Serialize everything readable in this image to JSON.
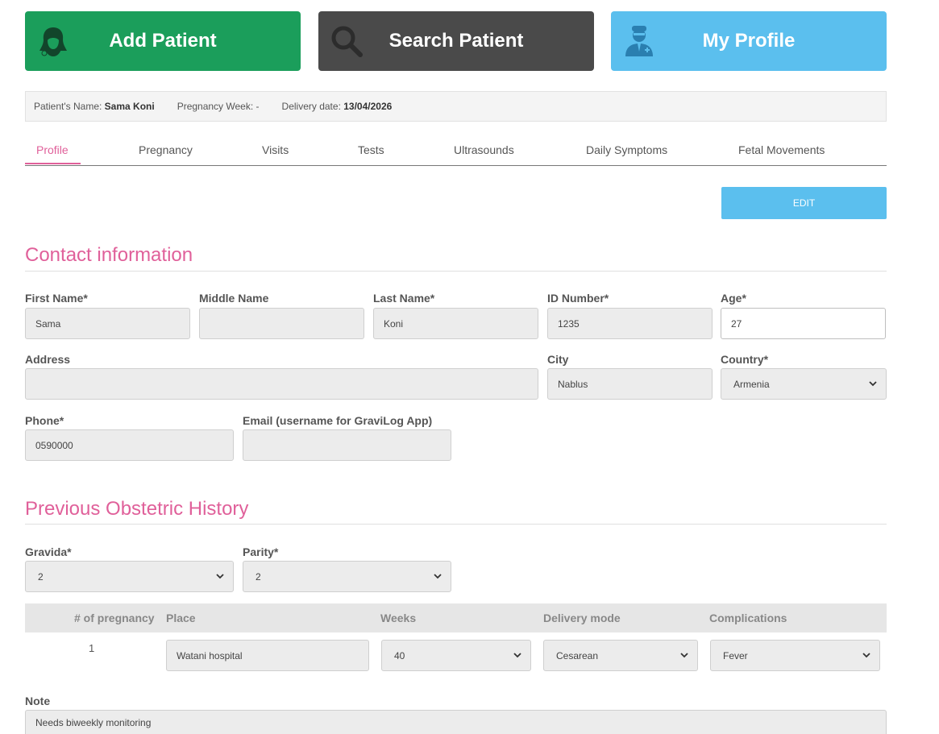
{
  "top_buttons": {
    "add": "Add Patient",
    "search": "Search Patient",
    "profile": "My Profile"
  },
  "info_bar": {
    "name_label": "Patient's Name:",
    "name_value": "Sama Koni",
    "week_label": "Pregnancy Week:",
    "week_value": "-",
    "delivery_label": "Delivery date:",
    "delivery_value": "13/04/2026"
  },
  "tabs": [
    "Profile",
    "Pregnancy",
    "Visits",
    "Tests",
    "Ultrasounds",
    "Daily Symptoms",
    "Fetal Movements"
  ],
  "edit_label": "EDIT",
  "contact": {
    "title": "Contact information",
    "first_name_label": "First Name*",
    "first_name": "Sama",
    "middle_name_label": "Middle Name",
    "middle_name": "",
    "last_name_label": "Last Name*",
    "last_name": "Koni",
    "id_label": "ID Number*",
    "id_value": "1235",
    "age_label": "Age*",
    "age": "27",
    "address_label": "Address",
    "address": "",
    "city_label": "City",
    "city": "Nablus",
    "country_label": "Country*",
    "country": "Armenia",
    "phone_label": "Phone*",
    "phone": "0590000",
    "email_label": "Email (username for GraviLog App)",
    "email": ""
  },
  "obstetric": {
    "title": "Previous Obstetric History",
    "gravida_label": "Gravida*",
    "gravida": "2",
    "parity_label": "Parity*",
    "parity": "2",
    "table_headers": {
      "num": "# of pregnancy",
      "place": "Place",
      "weeks": "Weeks",
      "mode": "Delivery mode",
      "complications": "Complications"
    },
    "rows": [
      {
        "num": "1",
        "place": "Watani hospital",
        "weeks": "40",
        "mode": "Cesarean",
        "complications": "Fever"
      }
    ],
    "note_label": "Note",
    "note": "Needs biweekly monitoring"
  },
  "colors": {
    "add": "#1b9e5b",
    "search": "#4a4a4a",
    "profile": "#5bbfee",
    "accent": "#e0609a"
  }
}
